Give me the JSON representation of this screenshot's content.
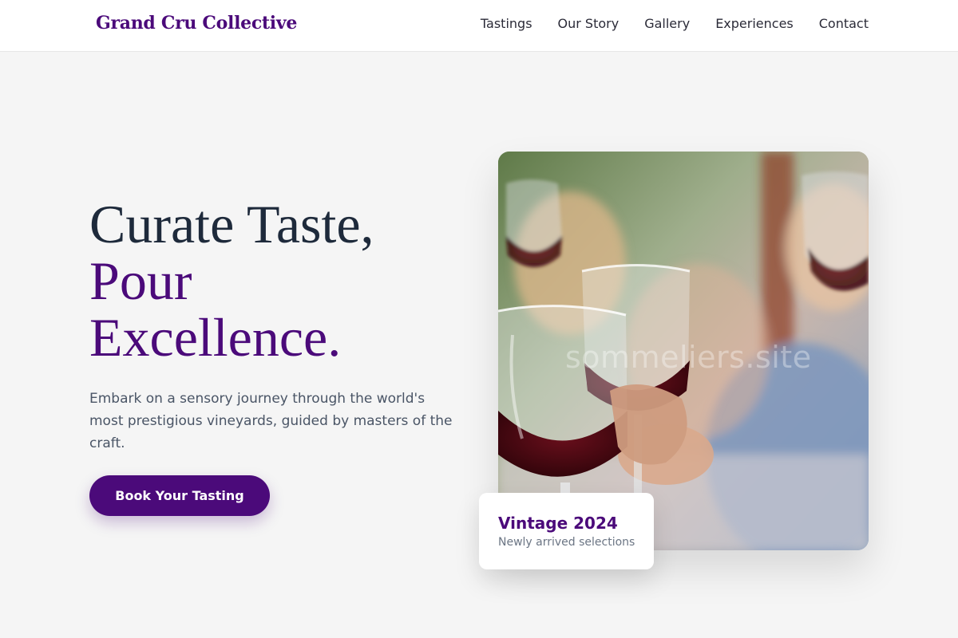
{
  "header": {
    "brand": "Grand Cru Collective",
    "nav": [
      "Tastings",
      "Our Story",
      "Gallery",
      "Experiences",
      "Contact"
    ]
  },
  "hero": {
    "headline_line1": "Curate Taste,",
    "headline_line2": "Pour",
    "headline_line3": "Excellence.",
    "subtext": "Embark on a sensory journey through the world's most prestigious vineyards, guided by masters of the craft.",
    "cta_label": "Book Your Tasting"
  },
  "image": {
    "watermark": "sommeliers.site",
    "alt_subject": "people toasting with glasses of red wine"
  },
  "badge": {
    "title": "Vintage 2024",
    "subtitle": "Newly arrived selections"
  },
  "colors": {
    "brand": "#4b0a7a",
    "heading": "#1e2a3b",
    "background": "#f5f5f5"
  }
}
